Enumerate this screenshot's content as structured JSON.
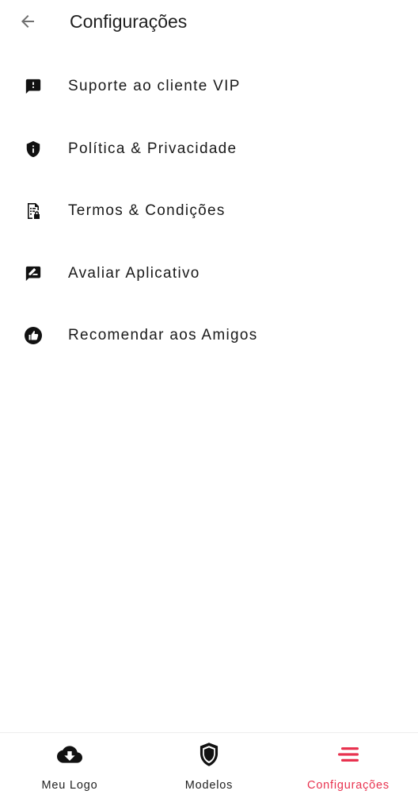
{
  "header": {
    "title": "Configurações",
    "back_icon": "arrow-left-icon"
  },
  "menu": {
    "items": [
      {
        "label": "Suporte ao cliente VIP",
        "icon": "chat-alert-icon"
      },
      {
        "label": "Política & Privacidade",
        "icon": "shield-info-icon"
      },
      {
        "label": "Termos & Condições",
        "icon": "document-lock-icon"
      },
      {
        "label": "Avaliar Aplicativo",
        "icon": "rate-review-icon"
      },
      {
        "label": "Recomendar aos Amigos",
        "icon": "thumb-up-icon"
      }
    ]
  },
  "bottom_nav": {
    "items": [
      {
        "label": "Meu Logo",
        "icon": "cloud-download-icon",
        "active": false
      },
      {
        "label": "Modelos",
        "icon": "shield-badge-icon",
        "active": false
      },
      {
        "label": "Configurações",
        "icon": "menu-lines-icon",
        "active": true
      }
    ]
  },
  "colors": {
    "accent": "#e8324f",
    "text": "#1a1a1a",
    "icon": "#111111",
    "background": "#ffffff"
  }
}
